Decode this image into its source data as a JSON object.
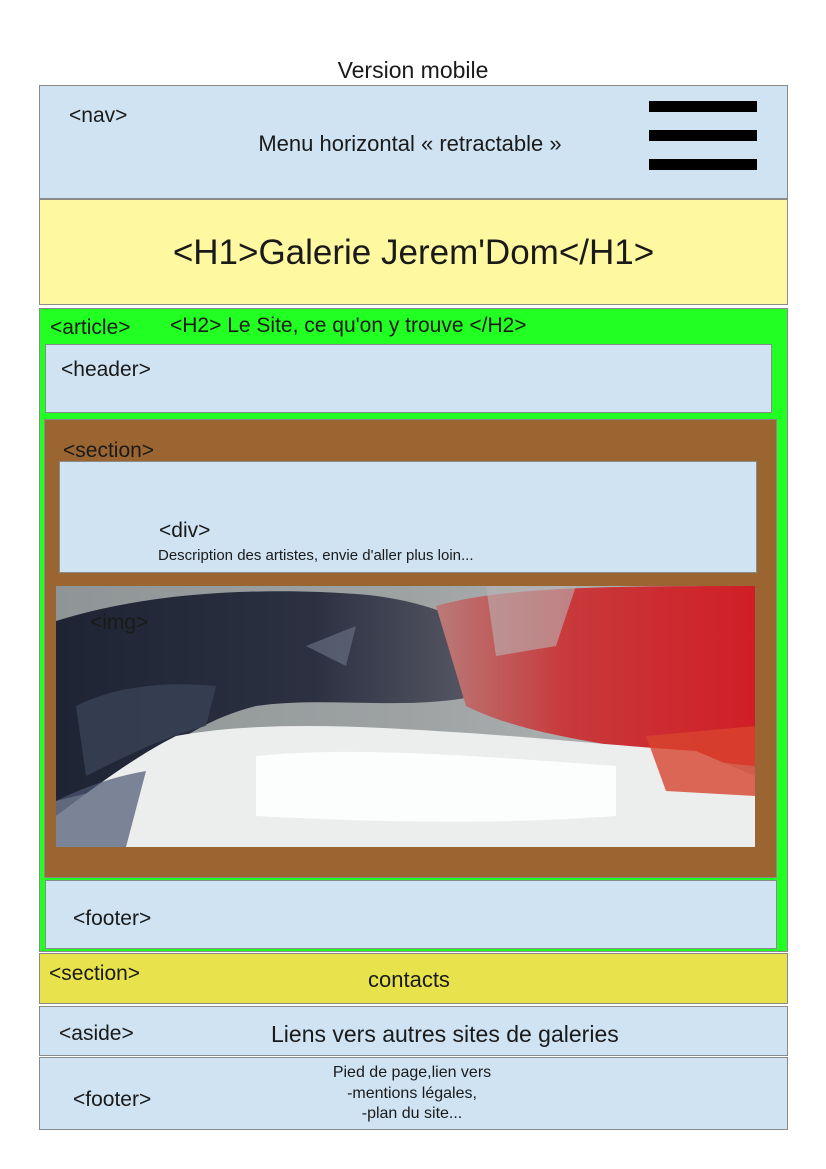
{
  "page_title": "Version mobile",
  "nav": {
    "tag": "<nav>",
    "text": "Menu horizontal « retractable »",
    "icon": "hamburger-menu-icon"
  },
  "h1_block": {
    "text": "<H1>Galerie Jerem'Dom</H1>"
  },
  "article": {
    "tag": "<article>",
    "h2": "<H2> Le Site, ce qu'on y trouve </H2>",
    "header_tag": "<header>",
    "section": {
      "tag": "<section>",
      "div_tag": "<div>",
      "div_text": "Description des artistes, envie d'aller plus loin...",
      "img_tag": "<img>"
    },
    "footer_tag": "<footer>"
  },
  "contacts_section": {
    "tag": "<section>",
    "text": "contacts"
  },
  "aside": {
    "tag": "<aside>",
    "text": "Liens vers autres sites de galeries"
  },
  "page_footer": {
    "tag": "<footer>",
    "lines": [
      "Pied de page,lien vers",
      "-mentions légales,",
      "-plan du site..."
    ]
  },
  "colors": {
    "light_blue": "#cfe3f2",
    "pale_yellow": "#fef9a0",
    "green": "#22ff22",
    "brown": "#9b6532",
    "yellow": "#e8e34c"
  }
}
